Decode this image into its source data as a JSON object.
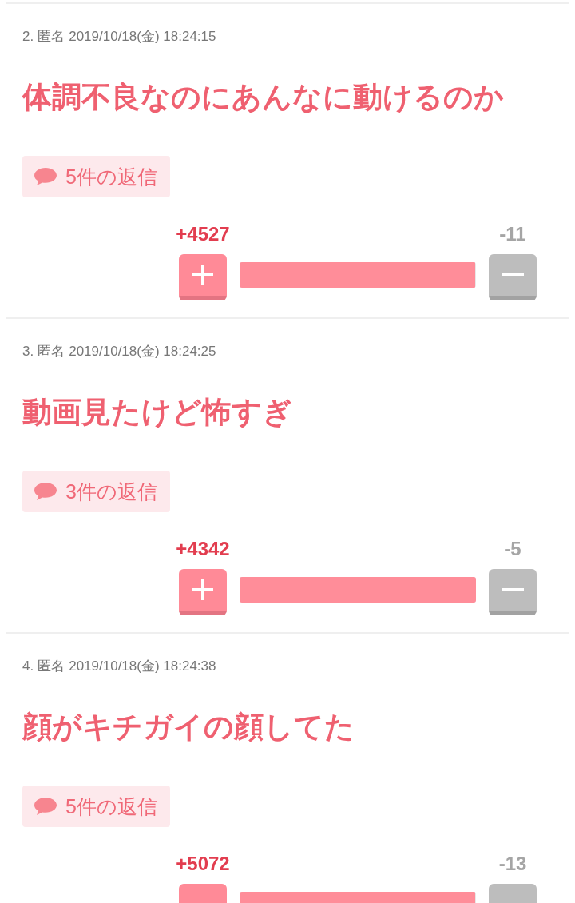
{
  "posts": [
    {
      "number": "2.",
      "name": "匿名",
      "date": "2019/10/18(金) 18:24:15",
      "body": "体調不良なのにあんなに動けるのか",
      "replies": "5件の返信",
      "plus_count": "+4527",
      "minus_count": "-11",
      "level": 0.998
    },
    {
      "number": "3.",
      "name": "匿名",
      "date": "2019/10/18(金) 18:24:25",
      "body": "動画見たけど怖すぎ",
      "replies": "3件の返信",
      "plus_count": "+4342",
      "minus_count": "-5",
      "level": 0.999
    },
    {
      "number": "4.",
      "name": "匿名",
      "date": "2019/10/18(金) 18:24:38",
      "body": "顔がキチガイの顔してた",
      "replies": "5件の返信",
      "plus_count": "+5072",
      "minus_count": "-13",
      "level": 0.997
    }
  ]
}
